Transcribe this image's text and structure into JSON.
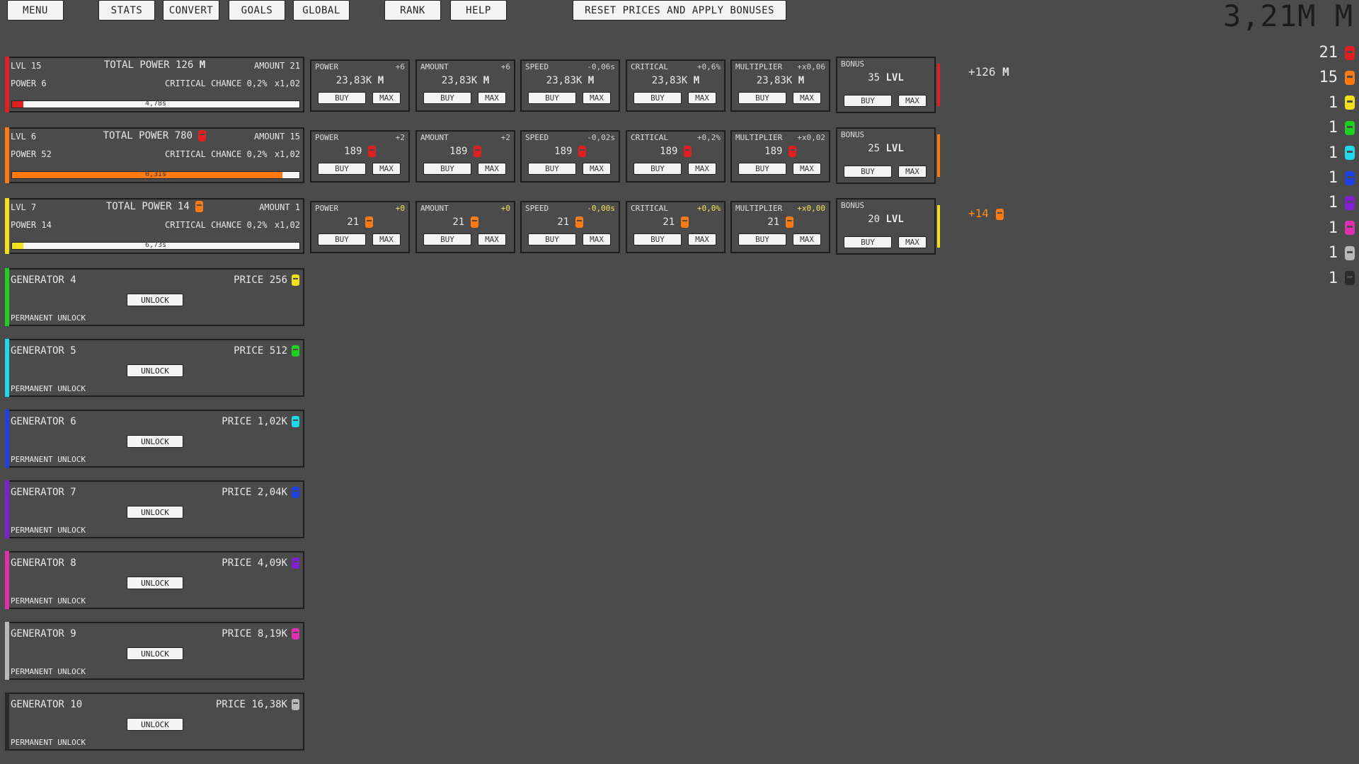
{
  "top_buttons": {
    "menu": "MENU",
    "stats": "STATS",
    "convert": "CONVERT",
    "goals": "GOALS",
    "global": "GLOBAL",
    "rank": "RANK",
    "help": "HELP",
    "reset": "RESET PRICES AND APPLY BONUSES"
  },
  "total_money": "3,21M",
  "total_money_unit": "M",
  "resources": [
    {
      "amount": "21",
      "color": "#e02020",
      "icon": "red-gem-icon"
    },
    {
      "amount": "15",
      "color": "#ff7a10",
      "icon": "orange-gem-icon"
    },
    {
      "amount": "1",
      "color": "#f2e020",
      "icon": "yellow-gem-icon"
    },
    {
      "amount": "1",
      "color": "#20d020",
      "icon": "green-gem-icon"
    },
    {
      "amount": "1",
      "color": "#20d8e8",
      "icon": "cyan-gem-icon"
    },
    {
      "amount": "1",
      "color": "#2040e0",
      "icon": "blue-gem-icon"
    },
    {
      "amount": "1",
      "color": "#8020d0",
      "icon": "purple-gem-icon"
    },
    {
      "amount": "1",
      "color": "#e030b0",
      "icon": "pink-gem-icon"
    },
    {
      "amount": "1",
      "color": "#b8b8b8",
      "icon": "gray-gem-icon"
    },
    {
      "amount": "1",
      "color": "#2a2a2a",
      "icon": "black-gem-icon"
    }
  ],
  "generators": [
    {
      "lvl": "LVL 15",
      "total_power": "TOTAL POWER 126",
      "total_unit": "M",
      "amount": "AMOUNT 21",
      "power": "POWER 6",
      "crit": "CRITICAL CHANCE 0,2%",
      "mult": "x1,02",
      "progress_text": "4,78s",
      "progress": 0.04,
      "color": "#e02020",
      "gain": "+126",
      "gain_unit": "M",
      "gain_color": "#e0e0e0",
      "upgrades": [
        {
          "name": "POWER",
          "delta": "+6",
          "price": "23,83K",
          "unit": "M",
          "hl": false
        },
        {
          "name": "AMOUNT",
          "delta": "+6",
          "price": "23,83K",
          "unit": "M",
          "hl": false
        },
        {
          "name": "SPEED",
          "delta": "-0,06s",
          "price": "23,83K",
          "unit": "M",
          "hl": false
        },
        {
          "name": "CRITICAL",
          "delta": "+0,6%",
          "price": "23,83K",
          "unit": "M",
          "hl": false
        },
        {
          "name": "MULTIPLIER",
          "delta": "+x0,06",
          "price": "23,83K",
          "unit": "M",
          "hl": false
        }
      ],
      "bonus": {
        "label": "BONUS",
        "lvl": "35",
        "lvl_unit": "LVL"
      }
    },
    {
      "lvl": "LVL 6",
      "total_power": "TOTAL POWER 780",
      "total_unit": "",
      "amount": "AMOUNT 15",
      "power": "POWER 52",
      "crit": "CRITICAL CHANCE 0,2%",
      "mult": "x1,02",
      "progress_text": "0,31s",
      "progress": 0.94,
      "color": "#ff7a10",
      "gain": "",
      "gain_unit": "",
      "gain_color": "#e0e0e0",
      "upgrades": [
        {
          "name": "POWER",
          "delta": "+2",
          "price": "189",
          "unit": "",
          "hl": false
        },
        {
          "name": "AMOUNT",
          "delta": "+2",
          "price": "189",
          "unit": "",
          "hl": false
        },
        {
          "name": "SPEED",
          "delta": "-0,02s",
          "price": "189",
          "unit": "",
          "hl": false
        },
        {
          "name": "CRITICAL",
          "delta": "+0,2%",
          "price": "189",
          "unit": "",
          "hl": false
        },
        {
          "name": "MULTIPLIER",
          "delta": "+x0,02",
          "price": "189",
          "unit": "",
          "hl": false
        }
      ],
      "bonus": {
        "label": "BONUS",
        "lvl": "25",
        "lvl_unit": "LVL"
      }
    },
    {
      "lvl": "LVL 7",
      "total_power": "TOTAL POWER 14",
      "total_unit": "",
      "amount": "AMOUNT 1",
      "power": "POWER 14",
      "crit": "CRITICAL CHANCE 0,2%",
      "mult": "x1,02",
      "progress_text": "6,73s",
      "progress": 0.04,
      "color": "#f2e020",
      "gain": "+14",
      "gain_unit": "",
      "gain_color": "#ff8a20",
      "upgrades": [
        {
          "name": "POWER",
          "delta": "+0",
          "price": "21",
          "unit": "",
          "hl": true
        },
        {
          "name": "AMOUNT",
          "delta": "+0",
          "price": "21",
          "unit": "",
          "hl": true
        },
        {
          "name": "SPEED",
          "delta": "-0,00s",
          "price": "21",
          "unit": "",
          "hl": true
        },
        {
          "name": "CRITICAL",
          "delta": "+0,0%",
          "price": "21",
          "unit": "",
          "hl": true
        },
        {
          "name": "MULTIPLIER",
          "delta": "+x0,00",
          "price": "21",
          "unit": "",
          "hl": true
        }
      ],
      "bonus": {
        "label": "BONUS",
        "lvl": "20",
        "lvl_unit": "LVL"
      }
    }
  ],
  "buy_label": "BUY",
  "max_label": "MAX",
  "locked_generators": [
    {
      "name": "GENERATOR 4",
      "price": "PRICE 256",
      "color": "#20d020",
      "gem_color": "#f2e020"
    },
    {
      "name": "GENERATOR 5",
      "price": "PRICE 512",
      "color": "#20d8e8",
      "gem_color": "#20d020"
    },
    {
      "name": "GENERATOR 6",
      "price": "PRICE 1,02K",
      "color": "#2040e0",
      "gem_color": "#20d8e8"
    },
    {
      "name": "GENERATOR 7",
      "price": "PRICE 2,04K",
      "color": "#8020d0",
      "gem_color": "#2040e0"
    },
    {
      "name": "GENERATOR 8",
      "price": "PRICE 4,09K",
      "color": "#e030b0",
      "gem_color": "#8020d0"
    },
    {
      "name": "GENERATOR 9",
      "price": "PRICE 8,19K",
      "color": "#b8b8b8",
      "gem_color": "#e030b0"
    },
    {
      "name": "GENERATOR 10",
      "price": "PRICE 16,38K",
      "color": "#2a2a2a",
      "gem_color": "#b8b8b8"
    }
  ],
  "unlock_label": "UNLOCK",
  "permanent_unlock_label": "PERMANENT UNLOCK"
}
